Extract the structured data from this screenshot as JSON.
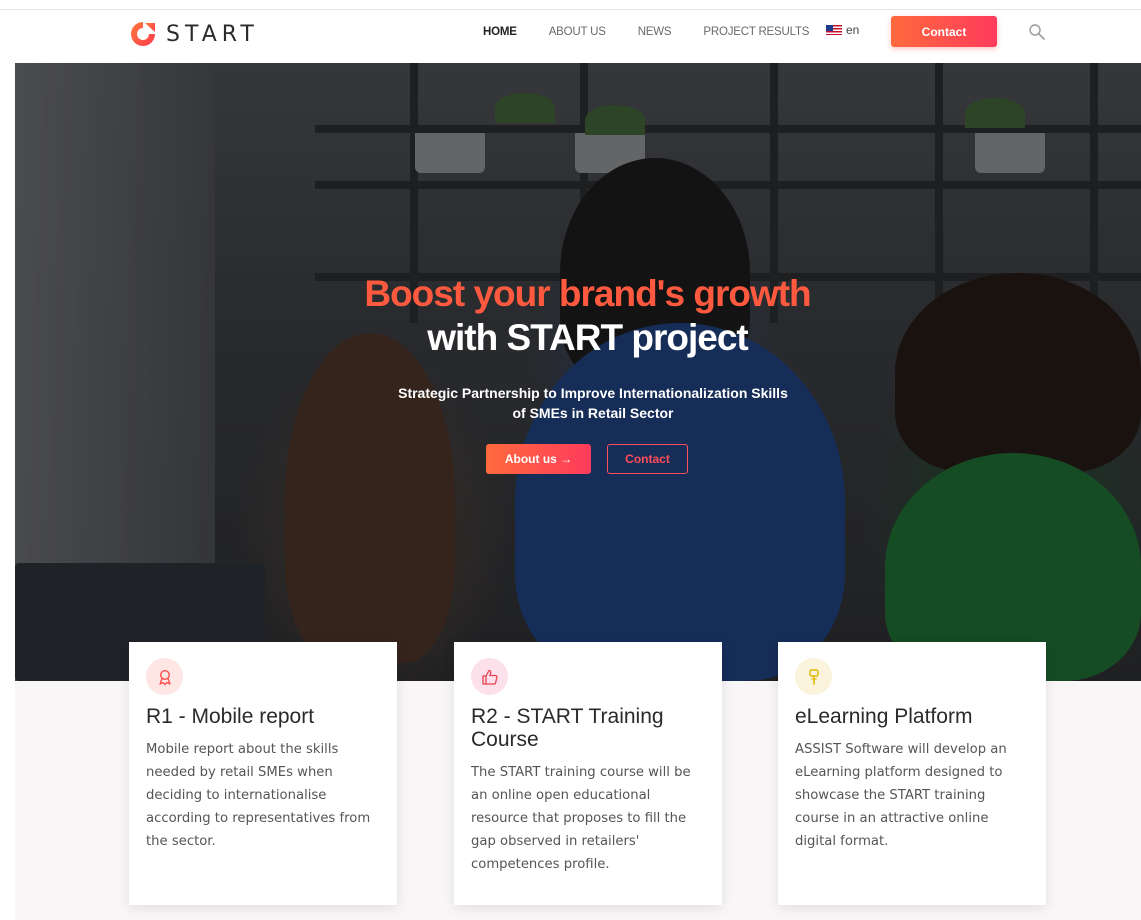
{
  "header": {
    "logo_text": "START",
    "nav": [
      "HOME",
      "ABOUT US",
      "NEWS",
      "PROJECT RESULTS"
    ],
    "language": "en",
    "contact_label": "Contact",
    "brand_color": "#ff5a3f"
  },
  "hero": {
    "title_line1": "Boost your brand's growth",
    "title_line2": "with START project",
    "subtitle_line1": "Strategic Partnership to Improve Internationalization Skills",
    "subtitle_line2": "of SMEs in Retail Sector",
    "about_label": "About us →",
    "contact_label": "Contact"
  },
  "cards": [
    {
      "icon": "award-icon",
      "title": "R1 - Mobile report",
      "text": "Mobile report about the skills needed by retail SMEs when deciding to internationalise according to representatives from the sector."
    },
    {
      "icon": "thumbs-up-icon",
      "title": "R2 - START Training Course",
      "text": "The START training course will be an online open educational resource that proposes to fill the gap observed in retailers' competences profile."
    },
    {
      "icon": "pin-icon",
      "title": "eLearning Platform",
      "text": "ASSIST Software will develop an eLearning platform designed to showcase the START training course in an attractive online digital format."
    }
  ]
}
